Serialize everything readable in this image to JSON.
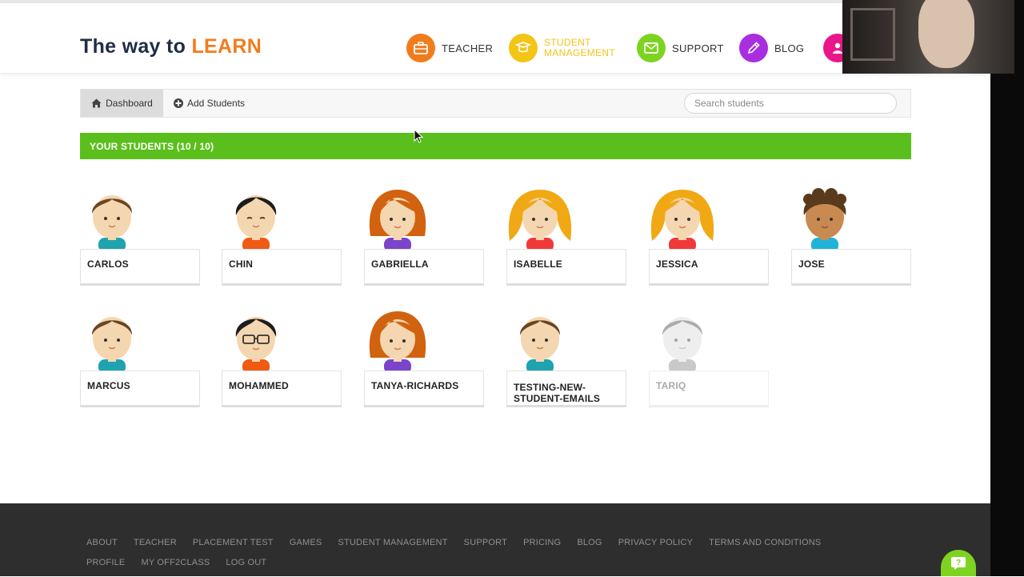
{
  "header": {
    "logo_prefix": "The way to ",
    "logo_accent": "LEARN",
    "nav": [
      {
        "label": "TEACHER",
        "color": "#f07c1e",
        "icon": "briefcase-icon"
      },
      {
        "label": "STUDENT MANAGEMENT",
        "line1": "STUDENT",
        "line2": "MANAGEMENT",
        "color": "#f3c517",
        "icon": "mortarboard-icon"
      },
      {
        "label": "SUPPORT",
        "color": "#7ed321",
        "icon": "envelope-icon"
      },
      {
        "label": "BLOG",
        "color": "#a92ee0",
        "icon": "pencil-icon"
      },
      {
        "label": "",
        "color": "#e9168b",
        "icon": "user-icon"
      }
    ]
  },
  "toolbar": {
    "dashboard_label": "Dashboard",
    "add_students_label": "Add Students",
    "search_placeholder": "Search students"
  },
  "banner": {
    "text": "YOUR STUDENTS (10 / 10)"
  },
  "students": [
    {
      "name": "CARLOS",
      "hair": "brown-short",
      "shirt": "#1fa3b0"
    },
    {
      "name": "CHIN",
      "hair": "black-short",
      "shirt": "#f05a12"
    },
    {
      "name": "GABRIELLA",
      "hair": "auburn-long",
      "shirt": "#7b45c9"
    },
    {
      "name": "ISABELLE",
      "hair": "blonde-long",
      "shirt": "#f03a3a"
    },
    {
      "name": "JESSICA",
      "hair": "blonde-long",
      "shirt": "#f03a3a"
    },
    {
      "name": "JOSE",
      "hair": "brown-curly",
      "shirt": "#1fb3d8"
    },
    {
      "name": "MARCUS",
      "hair": "brown-short",
      "shirt": "#1fa3b0"
    },
    {
      "name": "MOHAMMED",
      "hair": "black-glasses",
      "shirt": "#f05a12"
    },
    {
      "name": "TANYA-RICHARDS",
      "hair": "auburn-long",
      "shirt": "#7b45c9"
    },
    {
      "name": "TESTING-NEW-STUDENT-EMAILS",
      "line1": "TESTING-NEW-",
      "line2": "STUDENT-EMAILS",
      "hair": "brown-short",
      "shirt": "#1fa3b0"
    },
    {
      "name": "TARIQ",
      "hair": "brown-short",
      "shirt": "#1fa3b0",
      "state": "inactive"
    }
  ],
  "footer": {
    "links": [
      "ABOUT",
      "TEACHER",
      "PLACEMENT TEST",
      "GAMES",
      "STUDENT MANAGEMENT",
      "SUPPORT",
      "PRICING",
      "BLOG",
      "PRIVACY POLICY",
      "TERMS AND CONDITIONS",
      "PROFILE",
      "MY OFF2CLASS",
      "LOG OUT"
    ]
  },
  "colors": {
    "banner": "#5abf1c",
    "footer": "#2e2e2e",
    "logo_dark": "#1f2d46",
    "logo_accent": "#ef7d1e"
  }
}
